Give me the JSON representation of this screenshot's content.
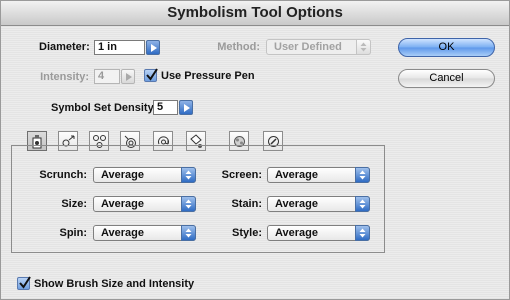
{
  "window": {
    "title": "Symbolism Tool Options"
  },
  "diameter": {
    "label": "Diameter:",
    "value": "1 in"
  },
  "method": {
    "label": "Method:",
    "value": "User Defined"
  },
  "intensity": {
    "label": "Intensity:",
    "value": "4"
  },
  "use_pressure_pen": {
    "label": "Use Pressure Pen",
    "checked": true
  },
  "symbol_set_density": {
    "label": "Symbol Set Density:",
    "value": "5"
  },
  "buttons": {
    "ok": "OK",
    "cancel": "Cancel"
  },
  "tabs": [
    {
      "icon": "symbol-sprayer-icon",
      "active": true
    },
    {
      "icon": "symbol-shifter-icon"
    },
    {
      "icon": "symbol-scruncher-icon"
    },
    {
      "icon": "symbol-sizer-icon"
    },
    {
      "icon": "symbol-spinner-icon"
    },
    {
      "icon": "symbol-stainer-icon"
    },
    {
      "icon": "symbol-screener-icon"
    },
    {
      "icon": "symbol-styler-icon"
    }
  ],
  "options": {
    "scrunch": {
      "label": "Scrunch:",
      "value": "Average"
    },
    "size": {
      "label": "Size:",
      "value": "Average"
    },
    "spin": {
      "label": "Spin:",
      "value": "Average"
    },
    "screen": {
      "label": "Screen:",
      "value": "Average"
    },
    "stain": {
      "label": "Stain:",
      "value": "Average"
    },
    "style": {
      "label": "Style:",
      "value": "Average"
    }
  },
  "show_brush_size": {
    "label": "Show Brush Size and Intensity",
    "checked": true
  },
  "colors": {
    "accent": "#2f6cc4",
    "background": "#e9e9e9"
  }
}
